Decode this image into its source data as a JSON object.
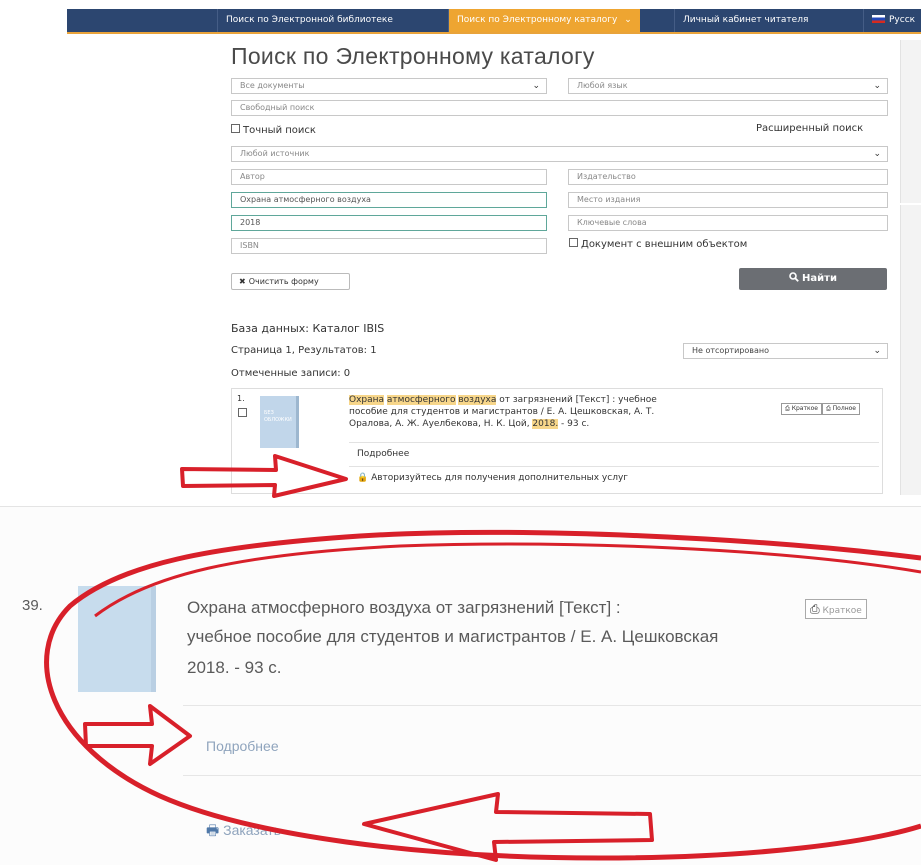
{
  "nav": {
    "items": [
      "Поиск по Электронной библиотеке",
      "Поиск по Электронному каталогу",
      "Личный кабинет читателя",
      "Русск"
    ],
    "chevron": "⌄"
  },
  "page_title": "Поиск по Электронному каталогу",
  "form": {
    "doc_type": "Все документы",
    "language": "Любой язык",
    "free_search_placeholder": "Свободный поиск",
    "exact_search_label": "Точный поиск",
    "advanced_search_label": "Расширенный поиск",
    "source": "Любой источник",
    "author_placeholder": "Автор",
    "title_value": "Охрана атмосферного воздуха",
    "year_value": "2018",
    "isbn_placeholder": "ISBN",
    "publisher_placeholder": "Издательство",
    "place_placeholder": "Место издания",
    "keywords_placeholder": "Ключевые слова",
    "external_object_label": "Документ с внешним объектом",
    "clear_button": "Очистить форму",
    "find_button": "Найти"
  },
  "results": {
    "database": "База данных: Каталог IBIS",
    "page_info": "Страница 1, Результатов: 1",
    "sort": "Не отсортировано",
    "marked": "Отмеченные записи: 0",
    "record": {
      "number": "1.",
      "cover_text": "БЕЗ ОБЛОЖКИ",
      "title_parts": [
        "Охрана",
        " ",
        "атмосферного",
        " ",
        "воздуха",
        " от загрязнений [Текст] : учебное"
      ],
      "line2": "пособие для студентов и магистрантов / Е. А. Цешковская, А. Т.",
      "line3_pre": "Оралова, А. Ж. Ауелбекова, Н. К. Цой, ",
      "line3_year": "2018.",
      "line3_post": " - 93 с.",
      "btn_short": "Краткое",
      "btn_full": "Полное",
      "details_link": "Подробнее",
      "login_link": "Авторизуйтесь для получения дополнительных услуг"
    }
  },
  "zoom": {
    "number": "39.",
    "line1": "Охрана атмосферного воздуха от загрязнений [Текст] :",
    "line2": "учебное пособие для студентов и магистрантов / Е. А. Цешковская",
    "line3": "2018. - 93 с.",
    "btn_short": "Краткое",
    "details_link": "Подробнее",
    "order_link": "Заказать"
  },
  "colors": {
    "nav_bg": "#2c4670",
    "nav_active": "#eea531",
    "highlight": "#f7d68a",
    "annotation_red": "#d8202a",
    "button_dark": "#6b6e73"
  }
}
